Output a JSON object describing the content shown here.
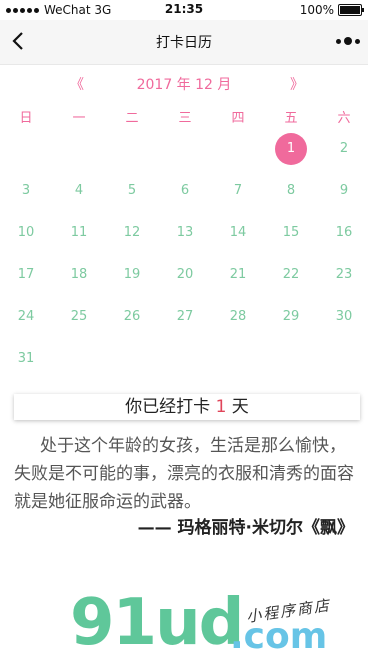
{
  "status": {
    "carrier": "WeChat 3G",
    "time": "21:35",
    "battery": "100%"
  },
  "nav": {
    "title": "打卡日历"
  },
  "calendar": {
    "prev": "《",
    "month_label": "2017 年 12 月",
    "next": "》",
    "weekdays": [
      "日",
      "一",
      "二",
      "三",
      "四",
      "五",
      "六"
    ],
    "highlight_day": 1,
    "accent": "#f06a9c",
    "day_color": "#7dcaa0"
  },
  "checkin": {
    "prefix": "你已经打卡 ",
    "count": "1",
    "suffix": " 天"
  },
  "quote": {
    "text": "处于这个年龄的女孩，生活是那么愉快，失败是不可能的事，漂亮的衣服和清秀的面容就是她征服命运的武器。",
    "attribution": "—— 玛格丽特·米切尔《飘》"
  },
  "logo": {
    "main": "91ud",
    "domain": ".com",
    "tagline": "小程序商店"
  }
}
